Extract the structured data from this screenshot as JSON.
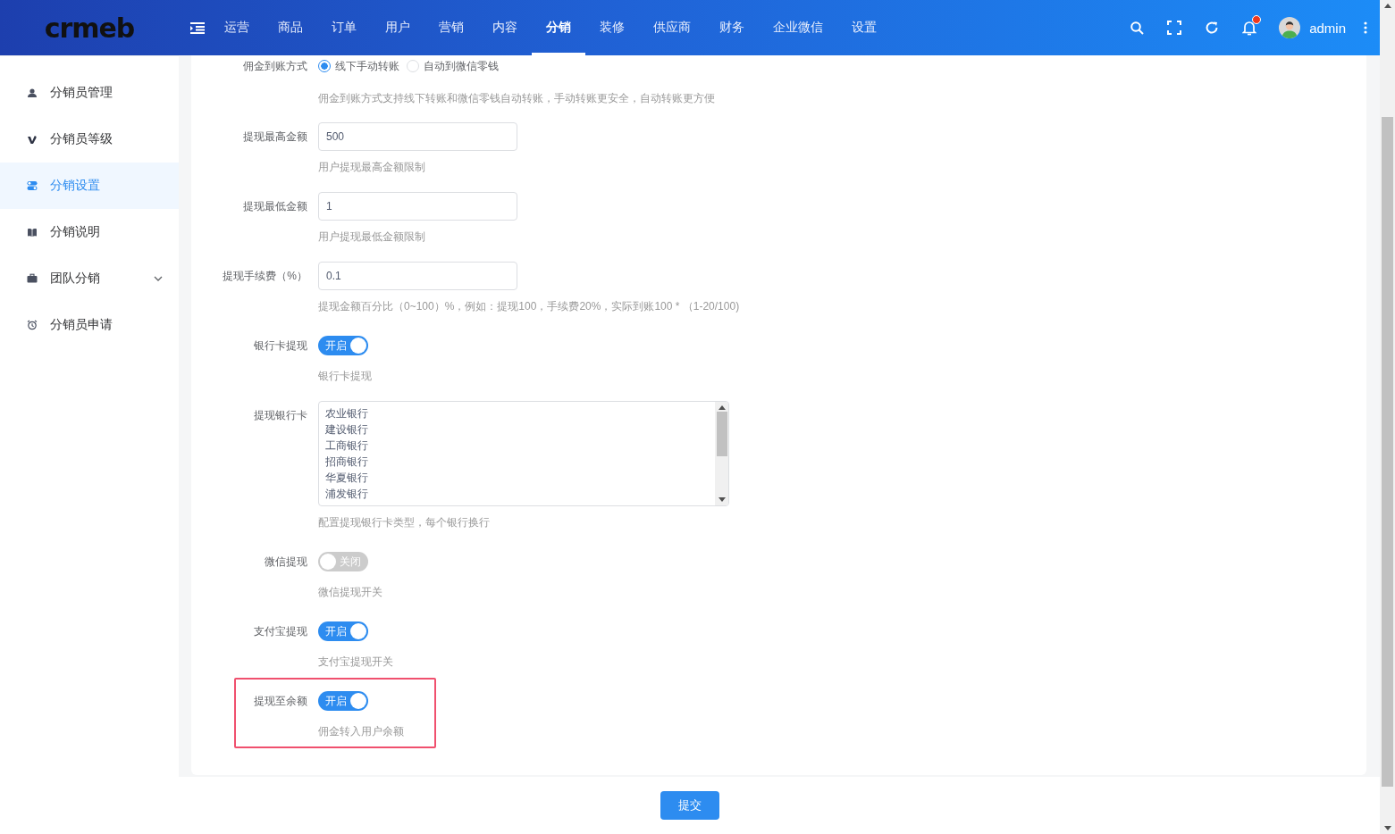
{
  "header": {
    "logo": "crmeb",
    "nav": [
      {
        "label": "运营",
        "selected": false
      },
      {
        "label": "商品",
        "selected": false
      },
      {
        "label": "订单",
        "selected": false
      },
      {
        "label": "用户",
        "selected": false
      },
      {
        "label": "营销",
        "selected": false
      },
      {
        "label": "内容",
        "selected": false
      },
      {
        "label": "分销",
        "selected": true
      },
      {
        "label": "装修",
        "selected": false
      },
      {
        "label": "供应商",
        "selected": false
      },
      {
        "label": "财务",
        "selected": false
      },
      {
        "label": "企业微信",
        "selected": false
      },
      {
        "label": "设置",
        "selected": false
      }
    ],
    "notification_dot": true,
    "user": "admin"
  },
  "sidebar": {
    "items": [
      {
        "label": "分销员管理",
        "selected": false,
        "expandable": false
      },
      {
        "label": "分销员等级",
        "selected": false,
        "expandable": false
      },
      {
        "label": "分销设置",
        "selected": true,
        "expandable": false
      },
      {
        "label": "分销说明",
        "selected": false,
        "expandable": false
      },
      {
        "label": "团队分销",
        "selected": false,
        "expandable": true
      },
      {
        "label": "分销员申请",
        "selected": false,
        "expandable": false
      }
    ]
  },
  "form": {
    "items": [
      {
        "kind": "radio",
        "label": "佣金到账方式",
        "options": [
          {
            "label": "线下手动转账",
            "selected": true
          },
          {
            "label": "自动到微信零钱",
            "selected": false
          }
        ],
        "hint": "佣金到账方式支持线下转账和微信零钱自动转账，手动转账更安全，自动转账更方便",
        "highlighted": false
      },
      {
        "kind": "input",
        "label": "提现最高金额",
        "value": "500",
        "hint": "用户提现最高金额限制",
        "highlighted": false
      },
      {
        "kind": "input",
        "label": "提现最低金额",
        "value": "1",
        "hint": "用户提现最低金额限制",
        "highlighted": false
      },
      {
        "kind": "input",
        "label": "提现手续费（%）",
        "value": "0.1",
        "hint": "提现金额百分比（0~100）%，例如：提现100，手续费20%，实际到账100 * （1-20/100)",
        "highlighted": false
      },
      {
        "kind": "switch",
        "label": "银行卡提现",
        "on": true,
        "text": "开启",
        "hint": "银行卡提现",
        "highlighted": false
      },
      {
        "kind": "textarea",
        "label": "提现银行卡",
        "lines": [
          "农业银行",
          "建设银行",
          "工商银行",
          "招商银行",
          "华夏银行",
          "浦发银行"
        ],
        "hint": "配置提现银行卡类型，每个银行换行",
        "highlighted": false
      },
      {
        "kind": "switch",
        "label": "微信提现",
        "on": false,
        "text": "关闭",
        "hint": "微信提现开关",
        "highlighted": false
      },
      {
        "kind": "switch",
        "label": "支付宝提现",
        "on": true,
        "text": "开启",
        "hint": "支付宝提现开关",
        "highlighted": false
      },
      {
        "kind": "switch",
        "label": "提现至余额",
        "on": true,
        "text": "开启",
        "hint": "佣金转入用户余额",
        "highlighted": true
      }
    ],
    "submit": "提交"
  }
}
